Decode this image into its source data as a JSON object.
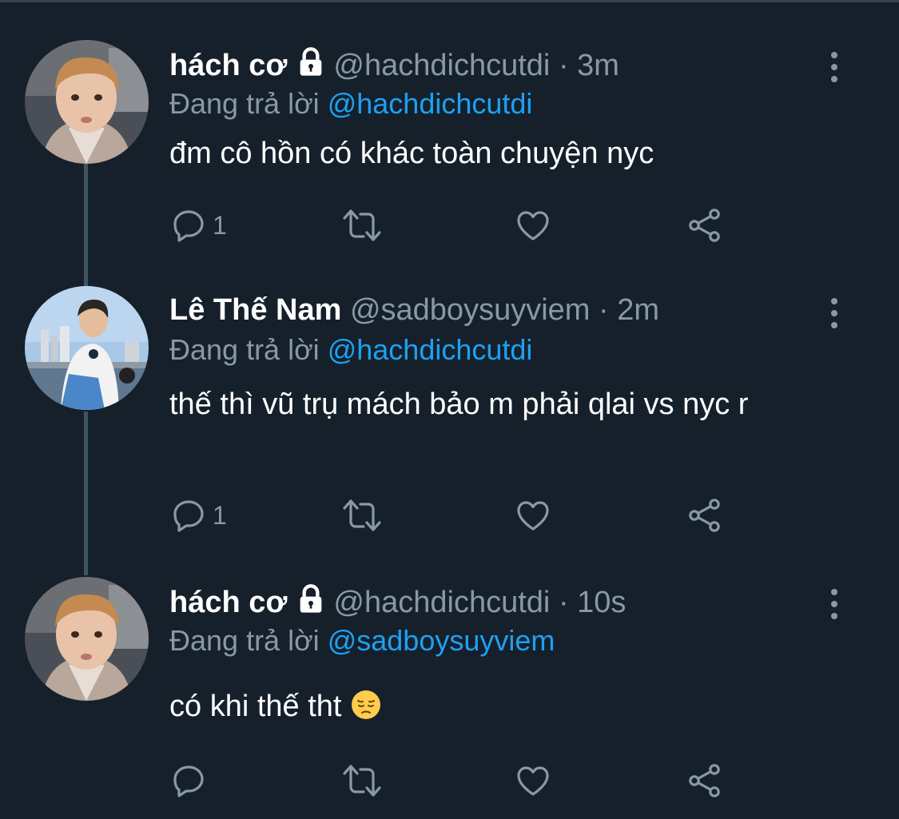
{
  "tweets": [
    {
      "name": "hách cơ",
      "locked": true,
      "handle": "@hachdichcutdi",
      "separator": "·",
      "time": "3m",
      "replying_prefix": "Đang trả lời",
      "replying_to": "@hachdichcutdi",
      "text": "đm cô hồn có khác toàn chuyện nyc",
      "reply_count": "1"
    },
    {
      "name": "Lê Thế Nam",
      "locked": false,
      "handle": "@sadboysuyviem",
      "separator": "·",
      "time": "2m",
      "replying_prefix": "Đang trả lời",
      "replying_to": "@hachdichcutdi",
      "text": "thế thì vũ trụ mách bảo m phải qlai vs nyc r",
      "reply_count": "1"
    },
    {
      "name": "hách cơ",
      "locked": true,
      "handle": "@hachdichcutdi",
      "separator": "·",
      "time": "10s",
      "replying_prefix": "Đang trả lời",
      "replying_to": "@sadboysuyviem",
      "text": "có khi thế tht",
      "emoji": "pensive-face",
      "reply_count": ""
    }
  ],
  "colors": {
    "background": "#15202b",
    "text": "#ffffff",
    "secondary": "#8899a6",
    "accent": "#1da1f2",
    "thread_line": "#3d5466"
  },
  "icons": [
    "lock-icon",
    "more-icon",
    "reply-icon",
    "retweet-icon",
    "like-icon",
    "share-icon"
  ]
}
